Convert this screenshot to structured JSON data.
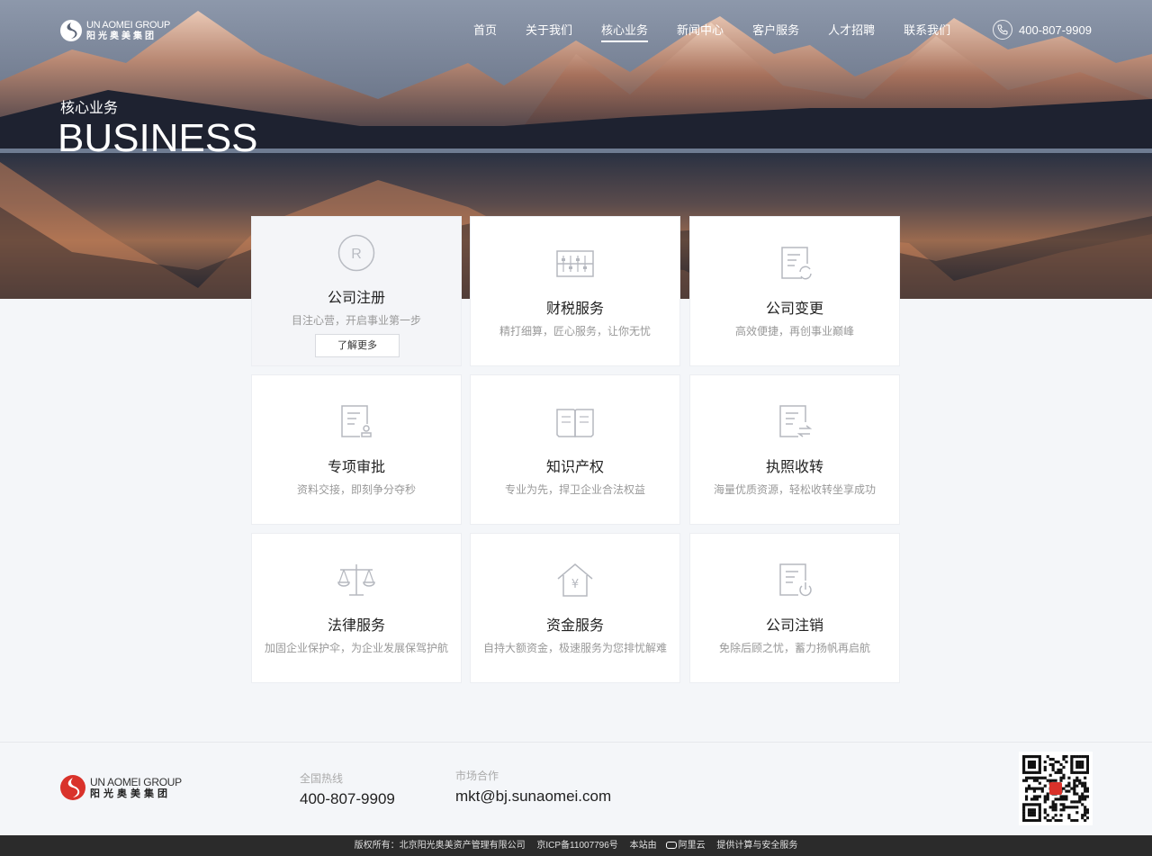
{
  "header": {
    "logo_en": "UN AOMEI GROUP",
    "logo_cn": "阳光奥美集团",
    "nav": [
      {
        "label": "首页"
      },
      {
        "label": "关于我们"
      },
      {
        "label": "核心业务",
        "active": true
      },
      {
        "label": "新闻中心"
      },
      {
        "label": "客户服务"
      },
      {
        "label": "人才招聘"
      },
      {
        "label": "联系我们"
      }
    ],
    "phone": "400-807-9909"
  },
  "hero": {
    "subtitle": "核心业务",
    "title": "BUSINESS"
  },
  "services": [
    {
      "title": "公司注册",
      "desc": "目注心营，开启事业第一步",
      "icon": "registered-icon",
      "more": "了解更多"
    },
    {
      "title": "财税服务",
      "desc": "精打细算，匠心服务，让你无忧",
      "icon": "abacus-icon"
    },
    {
      "title": "公司变更",
      "desc": "高效便捷，再创事业巅峰",
      "icon": "document-refresh-icon"
    },
    {
      "title": "专项审批",
      "desc": "资料交接，即刻争分夺秒",
      "icon": "document-stamp-icon"
    },
    {
      "title": "知识产权",
      "desc": "专业为先，捍卫企业合法权益",
      "icon": "open-book-icon"
    },
    {
      "title": "执照收转",
      "desc": "海量优质资源，轻松收转坐享成功",
      "icon": "document-transfer-icon"
    },
    {
      "title": "法律服务",
      "desc": "加固企业保护伞，为企业发展保驾护航",
      "icon": "scales-icon"
    },
    {
      "title": "资金服务",
      "desc": "自持大额资金，极速服务为您排忧解难",
      "icon": "house-yen-icon"
    },
    {
      "title": "公司注销",
      "desc": "免除后顾之忧，蓄力扬帆再启航",
      "icon": "document-power-icon"
    }
  ],
  "footer": {
    "logo_en": "UN AOMEI GROUP",
    "logo_cn": "阳光奥美集团",
    "hotline_label": "全国热线",
    "hotline": "400-807-9909",
    "market_label": "市场合作",
    "email": "mkt@bj.sunaomei.com",
    "copyright": "版权所有：北京阳光奥美资产管理有限公司",
    "icp": "京ICP备11007796号",
    "host_prefix": "本站由",
    "host_name": "阿里云",
    "host_suffix": "提供计算与安全服务"
  },
  "colors": {
    "accent_red": "#d9322b",
    "card_bg": "#ffffff",
    "page_bg": "#f4f6f9",
    "bottom_bar": "#2b2b2b"
  }
}
